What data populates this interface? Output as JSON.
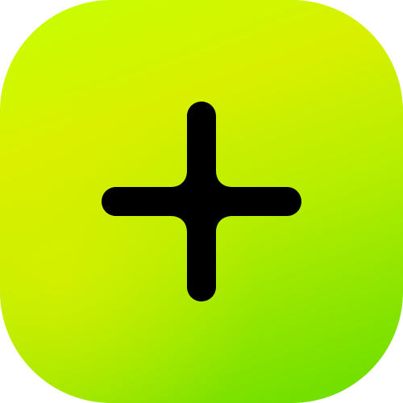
{
  "icon": {
    "name": "plus-icon",
    "gradient_colors": [
      "#c6ff00",
      "#d8f000",
      "#b8ee00",
      "#66dd00"
    ],
    "glyph_color": "#000000"
  }
}
